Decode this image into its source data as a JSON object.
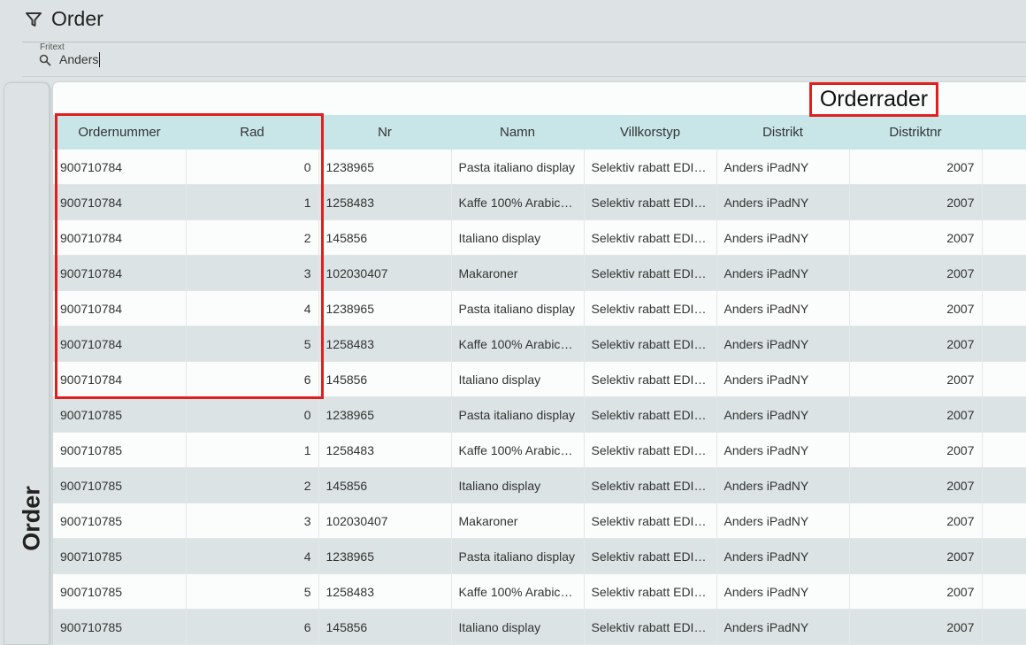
{
  "header": {
    "title": "Order"
  },
  "search": {
    "label": "Fritext",
    "value": "Anders"
  },
  "side_tab": {
    "label": "Order"
  },
  "panel": {
    "title": "Orderrader"
  },
  "table": {
    "columns": [
      "Ordernummer",
      "Rad",
      "Nr",
      "Namn",
      "Villkorstyp",
      "Distrikt",
      "Distriktnr",
      ""
    ],
    "rows": [
      [
        "900710784",
        "0",
        "1238965",
        "Pasta italiano display",
        "Selektiv rabatt EDI order",
        "Anders iPadNY",
        "2007",
        ""
      ],
      [
        "900710784",
        "1",
        "1258483",
        "Kaffe 100% Arabica 50...",
        "Selektiv rabatt EDI order",
        "Anders iPadNY",
        "2007",
        ""
      ],
      [
        "900710784",
        "2",
        "145856",
        "Italiano display",
        "Selektiv rabatt EDI order",
        "Anders iPadNY",
        "2007",
        ""
      ],
      [
        "900710784",
        "3",
        "102030407",
        "Makaroner",
        "Selektiv rabatt EDI order",
        "Anders iPadNY",
        "2007",
        ""
      ],
      [
        "900710784",
        "4",
        "1238965",
        "Pasta italiano display",
        "Selektiv rabatt EDI order",
        "Anders iPadNY",
        "2007",
        ""
      ],
      [
        "900710784",
        "5",
        "1258483",
        "Kaffe 100% Arabica 50...",
        "Selektiv rabatt EDI order",
        "Anders iPadNY",
        "2007",
        ""
      ],
      [
        "900710784",
        "6",
        "145856",
        "Italiano display",
        "Selektiv rabatt EDI order",
        "Anders iPadNY",
        "2007",
        ""
      ],
      [
        "900710785",
        "0",
        "1238965",
        "Pasta italiano display",
        "Selektiv rabatt EDI order",
        "Anders iPadNY",
        "2007",
        ""
      ],
      [
        "900710785",
        "1",
        "1258483",
        "Kaffe 100% Arabica 50...",
        "Selektiv rabatt EDI order",
        "Anders iPadNY",
        "2007",
        ""
      ],
      [
        "900710785",
        "2",
        "145856",
        "Italiano display",
        "Selektiv rabatt EDI order",
        "Anders iPadNY",
        "2007",
        ""
      ],
      [
        "900710785",
        "3",
        "102030407",
        "Makaroner",
        "Selektiv rabatt EDI order",
        "Anders iPadNY",
        "2007",
        ""
      ],
      [
        "900710785",
        "4",
        "1238965",
        "Pasta italiano display",
        "Selektiv rabatt EDI order",
        "Anders iPadNY",
        "2007",
        ""
      ],
      [
        "900710785",
        "5",
        "1258483",
        "Kaffe 100% Arabica 50...",
        "Selektiv rabatt EDI order",
        "Anders iPadNY",
        "2007",
        ""
      ],
      [
        "900710785",
        "6",
        "145856",
        "Italiano display",
        "Selektiv rabatt EDI order",
        "Anders iPadNY",
        "2007",
        ""
      ]
    ]
  },
  "icons": {
    "filter": "filter-icon",
    "search": "search-icon"
  },
  "colors": {
    "header_row": "#c8e6e8",
    "highlight": "#e02020",
    "alt_row": "#dbe3e4"
  }
}
